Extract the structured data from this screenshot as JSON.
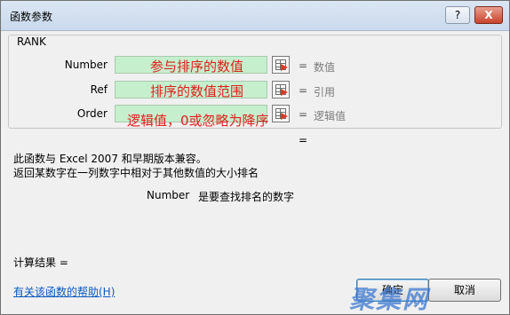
{
  "window": {
    "title": "函数参数",
    "help_button": "?",
    "close_button": "X"
  },
  "function_name": "RANK",
  "arguments": [
    {
      "label": "Number",
      "value": "",
      "note": "参与排序的数值",
      "equals": "=",
      "result": "数值"
    },
    {
      "label": "Ref",
      "value": "",
      "note": "排序的数值范围",
      "equals": "=",
      "result": "引用"
    },
    {
      "label": "Order",
      "value": "",
      "note": "逻辑值，0或忽略为降序",
      "equals": "=",
      "result": "逻辑值"
    }
  ],
  "result_equals": "=",
  "description": {
    "line1": "此函数与 Excel 2007 和早期版本兼容。",
    "line2": "返回某数字在一列数字中相对于其他数值的大小排名"
  },
  "param_help": {
    "name": "Number",
    "text": "是要查找排名的数字"
  },
  "calc_result": "计算结果 =",
  "help_link": "有关该函数的帮助(H)",
  "buttons": {
    "ok": "确定",
    "cancel": "取消"
  },
  "watermark": "聚集网",
  "colors": {
    "input_fill": "#c6efce",
    "note_text": "#e0201b",
    "link": "#0a58c2"
  }
}
